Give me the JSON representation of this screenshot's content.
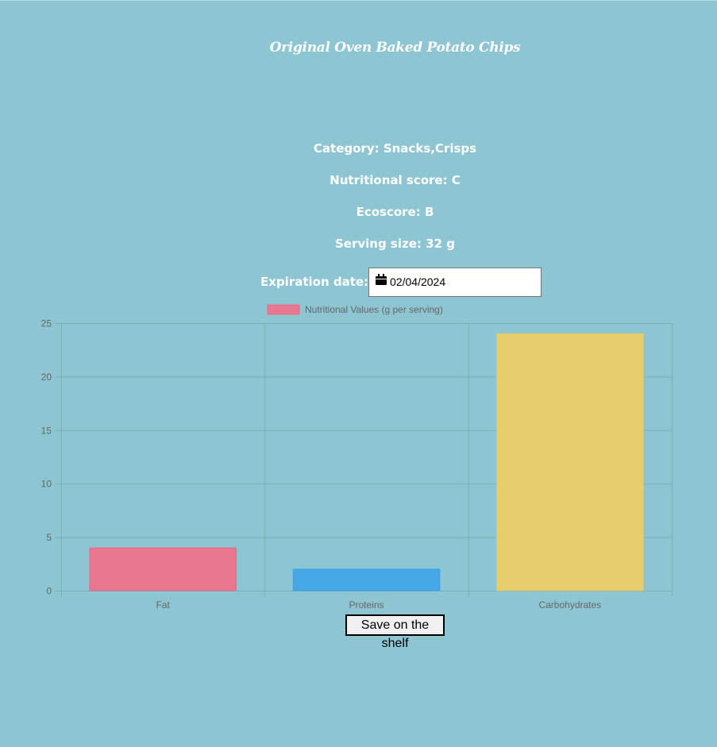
{
  "product": {
    "title": "Original Oven Baked Potato Chips"
  },
  "details": [
    {
      "label": "Category: ",
      "value": "Snacks,Crisps"
    },
    {
      "label": "Nutritional score: ",
      "value": "C"
    },
    {
      "label": "Ecoscore: ",
      "value": "B"
    },
    {
      "label": "Serving size: ",
      "value": "32 g"
    }
  ],
  "expiration": {
    "label": "Expiration date:",
    "value": "02/04/2024",
    "icon": "calendar-icon"
  },
  "actions": {
    "save_label": "Save on the shelf"
  },
  "colors": {
    "background": "#8dc6d2",
    "fat": "#e8778f",
    "proteins": "#46a8e4",
    "carbohydrates": "#e6cd6e",
    "fat_border": "#e66e8a",
    "proteins_border": "#36a2eb",
    "carbohydrates_border": "#e6c85e"
  },
  "chart_data": {
    "type": "bar",
    "categories": [
      "Fat",
      "Proteins",
      "Carbohydrates"
    ],
    "series": [
      {
        "name": "Nutritional Values (g per serving)",
        "values": [
          4,
          2,
          24
        ]
      }
    ],
    "ylim": [
      0,
      25
    ],
    "yticks": [
      0,
      5,
      10,
      15,
      20,
      25
    ],
    "grid": true,
    "legend": "top-center"
  }
}
